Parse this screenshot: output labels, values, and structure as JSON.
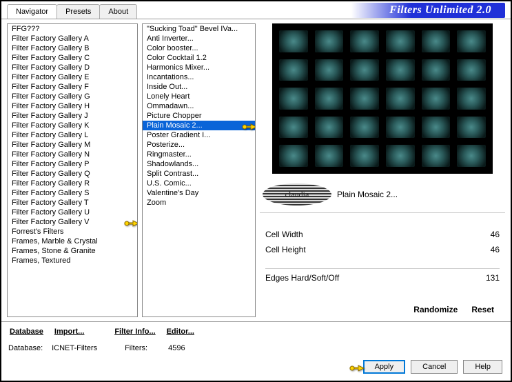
{
  "title": "Filters Unlimited 2.0",
  "tabs": [
    {
      "label": "Navigator",
      "active": true
    },
    {
      "label": "Presets",
      "active": false
    },
    {
      "label": "About",
      "active": false
    }
  ],
  "categories": [
    "FFG???",
    "Filter Factory Gallery A",
    "Filter Factory Gallery B",
    "Filter Factory Gallery C",
    "Filter Factory Gallery D",
    "Filter Factory Gallery E",
    "Filter Factory Gallery F",
    "Filter Factory Gallery G",
    "Filter Factory Gallery H",
    "Filter Factory Gallery J",
    "Filter Factory Gallery K",
    "Filter Factory Gallery L",
    "Filter Factory Gallery M",
    "Filter Factory Gallery N",
    "Filter Factory Gallery P",
    "Filter Factory Gallery Q",
    "Filter Factory Gallery R",
    "Filter Factory Gallery S",
    "Filter Factory Gallery T",
    "Filter Factory Gallery U",
    "Filter Factory Gallery V",
    "Forrest's Filters",
    "Frames, Marble & Crystal",
    "Frames, Stone & Granite",
    "Frames, Textured"
  ],
  "selected_category_index": 20,
  "filters": [
    "\"Sucking Toad\"  Bevel IVa...",
    "Anti Inverter...",
    "Color booster...",
    "Color Cocktail 1.2",
    "Harmonics Mixer...",
    "Incantations...",
    "Inside Out...",
    "Lonely Heart",
    "Ommadawn...",
    "Picture Chopper",
    "Plain Mosaic 2...",
    "Poster Gradient I...",
    "Posterize...",
    "Ringmaster...",
    "Shadowlands...",
    "Split Contrast...",
    "U.S. Comic...",
    "Valentine's Day",
    "Zoom"
  ],
  "selected_filter_index": 10,
  "current_filter": "Plain Mosaic 2...",
  "watermark": "claudia",
  "params": [
    {
      "name": "Cell Width",
      "value": "46"
    },
    {
      "name": "Cell Height",
      "value": "46"
    },
    {
      "gap": true
    },
    {
      "name": "Edges Hard/Soft/Off",
      "value": "131"
    }
  ],
  "toolbar": {
    "database": "Database",
    "import": "Import...",
    "filter_info": "Filter Info...",
    "editor": "Editor...",
    "randomize": "Randomize",
    "reset": "Reset"
  },
  "status": {
    "db_label": "Database:",
    "db_value": "ICNET-Filters",
    "filters_label": "Filters:",
    "filters_value": "4596"
  },
  "buttons": {
    "apply": "Apply",
    "cancel": "Cancel",
    "help": "Help"
  }
}
